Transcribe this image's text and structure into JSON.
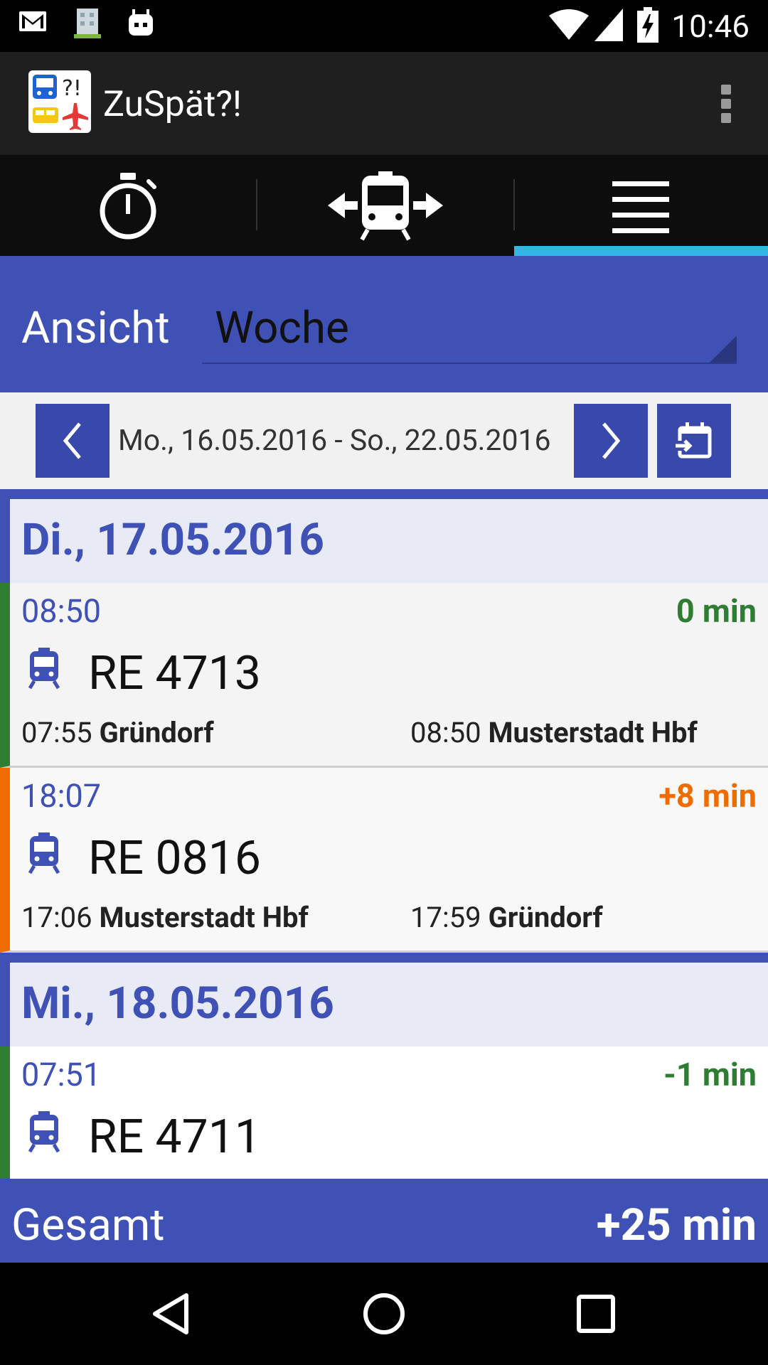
{
  "status_bar": {
    "time": "10:46"
  },
  "app": {
    "title": "ZuSpät?!"
  },
  "view": {
    "label": "Ansicht",
    "value": "Woche"
  },
  "date_range": "Mo., 16.05.2016 - So., 22.05.2016",
  "days": [
    {
      "header": "Di., 17.05.2016",
      "entries": [
        {
          "time": "08:50",
          "delay": "0 min",
          "train": "RE 4713",
          "dep_time": "07:55",
          "dep_station": "Gründorf",
          "arr_time": "08:50",
          "arr_station": "Musterstadt Hbf"
        },
        {
          "time": "18:07",
          "delay": "+8 min",
          "train": "RE 0816",
          "dep_time": "17:06",
          "dep_station": "Musterstadt Hbf",
          "arr_time": "17:59",
          "arr_station": "Gründorf"
        }
      ]
    },
    {
      "header": "Mi., 18.05.2016",
      "entries": [
        {
          "time": "07:51",
          "delay": "-1 min",
          "train": "RE 4711"
        }
      ]
    }
  ],
  "total": {
    "label": "Gesamt",
    "value": "+25 min"
  },
  "colors": {
    "primary": "#3f51b5",
    "on_time": "#2e7d32",
    "late": "#ef6c00",
    "tab_indicator": "#33b5e5"
  }
}
